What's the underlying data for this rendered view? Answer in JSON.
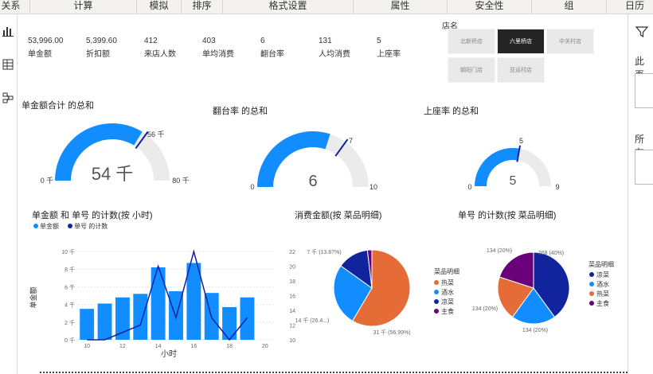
{
  "ribbon": {
    "tabs": [
      "关系",
      "计算",
      "模拟",
      "排序",
      "格式设置",
      "属性",
      "安全性",
      "组",
      "日历"
    ]
  },
  "left_icons": [
    "bar-chart-icon",
    "table-icon",
    "model-icon"
  ],
  "right_pane": {
    "label_1": "此页",
    "label_2": "所有",
    "icon": "filter-icon"
  },
  "kpis": [
    {
      "value": "53,996.00",
      "label": "单金额"
    },
    {
      "value": "5,399.60",
      "label": "折扣额"
    },
    {
      "value": "412",
      "label": "来店人数"
    },
    {
      "value": "403",
      "label": "单均消费"
    },
    {
      "value": "6",
      "label": "翻台率"
    },
    {
      "value": "131",
      "label": "人均消费"
    },
    {
      "value": "5",
      "label": "上座率"
    }
  ],
  "slicer": {
    "title": "店名",
    "items": [
      "北新桥店",
      "六里桥店",
      "中关村店",
      "朝阳门店",
      "亚运村店"
    ],
    "selected": "六里桥店"
  },
  "gauges": [
    {
      "title": "单金额合计 的总和",
      "value_label": "54 千",
      "min_label": "0 千",
      "max_label": "80 千",
      "target_label": "56 千",
      "value": 54,
      "min": 0,
      "max": 80,
      "target": 56
    },
    {
      "title": "翻台率 的总和",
      "value_label": "6",
      "min_label": "0",
      "max_label": "10",
      "target_label": "7",
      "value": 6,
      "min": 0,
      "max": 10,
      "target": 7
    },
    {
      "title": "上座率 的总和",
      "value_label": "5",
      "min_label": "0",
      "max_label": "9",
      "target_label": "5",
      "value": 5,
      "min": 0,
      "max": 9,
      "target": 5
    }
  ],
  "colors": {
    "blue": "#118dff",
    "dark_navy": "#12239e",
    "orange": "#e66c37",
    "purple": "#6b007b",
    "gauge_track": "#ebebeb"
  },
  "chart_data": [
    {
      "type": "bar",
      "title": "单金额 和 单号 的计数(按 小时)",
      "legend": [
        "单金额",
        "单号 的计数"
      ],
      "xlabel": "小时",
      "ylabel": "单金额",
      "x_ticks": [
        "10",
        "12",
        "14",
        "16",
        "18",
        "20"
      ],
      "y_ticks": [
        "0 千",
        "2 千",
        "4 千",
        "6 千",
        "8 千",
        "10 千"
      ],
      "y2_ticks": [
        "10",
        "12",
        "14",
        "16",
        "18",
        "20",
        "22"
      ],
      "ylim": [
        0,
        10
      ],
      "y2lim": [
        10,
        22
      ],
      "xlim": [
        9.5,
        20.5
      ],
      "x": [
        10,
        11,
        12,
        13,
        14,
        15,
        16,
        17,
        18,
        19
      ],
      "series": [
        {
          "name": "单金额",
          "kind": "bar",
          "values": [
            3.5,
            4.1,
            4.8,
            5.2,
            8.2,
            5.5,
            8.7,
            5.3,
            3.7,
            4.8
          ]
        },
        {
          "name": "单号 的计数",
          "kind": "line",
          "values": [
            10,
            10,
            11,
            12,
            20,
            13,
            22,
            13,
            10,
            13
          ]
        }
      ]
    },
    {
      "type": "pie",
      "title": "消费金额(按 菜品明细)",
      "legend_title": "菜品明细",
      "categories": [
        "热菜",
        "酒水",
        "凉菜",
        "主食"
      ],
      "values": [
        31,
        14,
        7,
        1
      ],
      "labels": [
        "31 千\n(56.99%)",
        "14 千\n(26.4...)",
        "7 千\n(13.87%)",
        ""
      ]
    },
    {
      "type": "pie",
      "title": "单号 的计数(按 菜品明细)",
      "legend_title": "菜品明细",
      "categories": [
        "凉菜",
        "酒水",
        "热菜",
        "主食"
      ],
      "values": [
        268,
        134,
        134,
        134
      ],
      "labels": [
        "268\n(40%)",
        "134 (20%)",
        "134\n(20%)",
        "134 (20%)"
      ]
    }
  ]
}
